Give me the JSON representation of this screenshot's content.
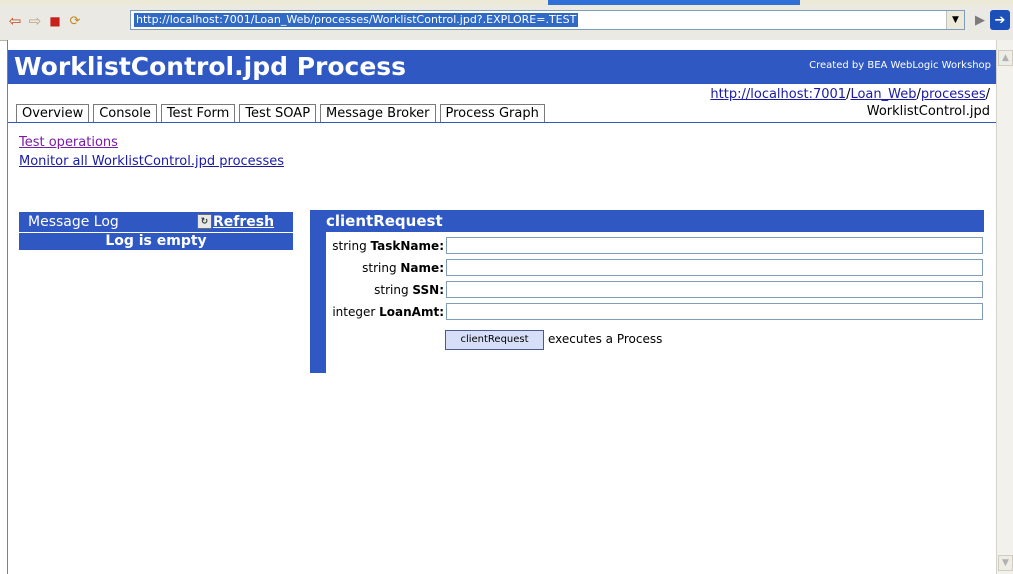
{
  "browser": {
    "address": "http://localhost:7001/Loan_Web/processes/WorklistControl.jpd?.EXPLORE=.TEST"
  },
  "page": {
    "title": "WorklistControl.jpd Process",
    "credit": "Created by BEA WebLogic Workshop",
    "crumb": {
      "host": "http://localhost:7001",
      "sep1": "/",
      "app": "Loan_Web",
      "sep2": "/",
      "folder": "processes",
      "sep3": "/",
      "file": "WorklistControl.jpd"
    },
    "tabs": [
      "Overview",
      "Console",
      "Test Form",
      "Test SOAP",
      "Message Broker",
      "Process Graph"
    ],
    "links": {
      "test_operations": "Test operations",
      "monitor": "Monitor all WorklistControl.jpd processes"
    }
  },
  "message_log": {
    "title": "Message Log",
    "refresh": "Refresh",
    "empty": "Log is empty"
  },
  "client_request": {
    "title": "clientRequest",
    "fields": [
      {
        "type": "string",
        "name": "TaskName",
        "colon": ":",
        "value": ""
      },
      {
        "type": "string",
        "name": "Name",
        "colon": ":",
        "value": ""
      },
      {
        "type": "string",
        "name": "SSN",
        "colon": ":",
        "value": ""
      },
      {
        "type": "integer",
        "name": "LoanAmt",
        "colon": ":",
        "value": ""
      }
    ],
    "button": "clientRequest",
    "note": "executes a Process"
  }
}
